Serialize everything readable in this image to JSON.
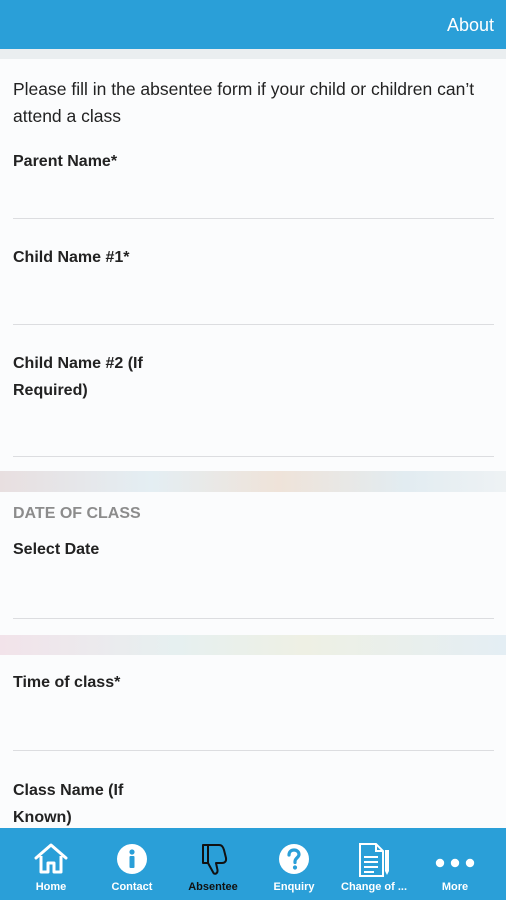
{
  "header": {
    "about_label": "About"
  },
  "form": {
    "intro": "Please fill in the absentee form if your child or children can’t attend a class",
    "parent_name_label": "Parent Name*",
    "child1_label": "Child Name #1*",
    "child2_label": "Child Name #2 (If Required)",
    "date_section_title": "DATE OF CLASS",
    "select_date_label": "Select Date",
    "time_label": "Time of class*",
    "class_name_label": "Class Name (If Known)"
  },
  "nav": {
    "items": [
      {
        "label": "Home",
        "icon": "home-icon"
      },
      {
        "label": "Contact",
        "icon": "info-icon"
      },
      {
        "label": "Absentee",
        "icon": "thumbs-down-icon",
        "active": true
      },
      {
        "label": "Enquiry",
        "icon": "question-icon"
      },
      {
        "label": "Change of ...",
        "icon": "document-edit-icon"
      },
      {
        "label": "More",
        "icon": "more-icon"
      }
    ]
  },
  "colors": {
    "brand": "#2a9fd8",
    "card": "#fbfcfd",
    "divider": "#dcdde0"
  }
}
